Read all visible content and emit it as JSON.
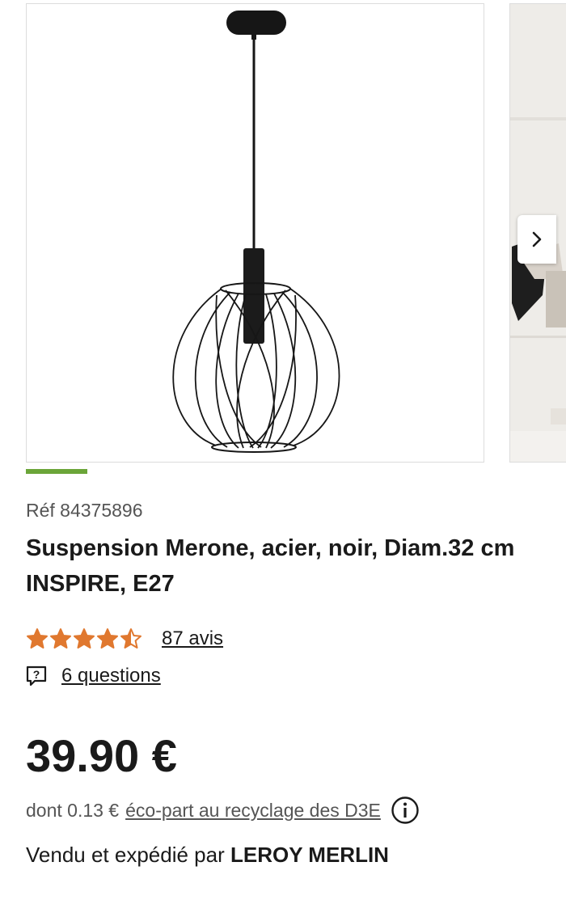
{
  "gallery": {
    "main_image_icon": "pendant-lamp-wire-cage",
    "next_image_icon": "interior-room-photo",
    "next_button_icon": "chevron-right-icon",
    "progress": 0.12
  },
  "product": {
    "reference": "Réf 84375896",
    "title_line1": "Suspension Merone, acier, noir, Diam.32 cm",
    "title_line2": "INSPIRE, E27"
  },
  "rating": {
    "value": 4.5,
    "max": 5,
    "reviews_label": "87 avis",
    "star_color": "#e0782f"
  },
  "questions": {
    "icon": "question-bubble-icon",
    "label": "6 questions"
  },
  "price": {
    "amount": "39.90 €"
  },
  "eco_part": {
    "prefix": "dont 0.13 €",
    "link_label": "éco-part au recyclage des D3E",
    "icon": "info-icon"
  },
  "seller": {
    "prefix": "Vendu et expédié par ",
    "name": "LEROY MERLIN"
  },
  "colors": {
    "accent_green": "#6ba539",
    "text_dark": "#1a1a1a",
    "text_muted": "#555555"
  }
}
